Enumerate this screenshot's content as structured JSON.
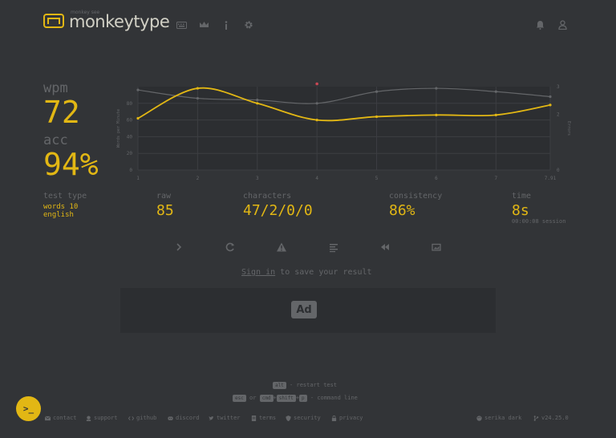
{
  "header": {
    "logo_sub": "monkey see",
    "logo_text": "monkeytype",
    "nav_icons": [
      "keyboard-icon",
      "crown-icon",
      "info-icon",
      "gear-icon"
    ],
    "right_icons": [
      "bell-icon",
      "user-icon"
    ]
  },
  "stats": {
    "wpm_label": "wpm",
    "wpm": "72",
    "acc_label": "acc",
    "acc": "94%",
    "test_type_label": "test type",
    "test_type_line1": "words 10",
    "test_type_line2": "english",
    "raw_label": "raw",
    "raw": "85",
    "characters_label": "characters",
    "characters": "47/2/0/0",
    "consistency_label": "consistency",
    "consistency": "86%",
    "time_label": "time",
    "time": "8s",
    "session": "00:00:08 session"
  },
  "chart_data": {
    "type": "line",
    "x": [
      1,
      2,
      3,
      4,
      5,
      6,
      7,
      7.91
    ],
    "xtick_labels": [
      "1",
      "2",
      "3",
      "4",
      "5",
      "6",
      "7",
      "7.91"
    ],
    "ylabel": "Words per Minute",
    "y2label": "Errors",
    "ylim": [
      0,
      100
    ],
    "yticks": [
      0,
      20,
      40,
      60,
      80
    ],
    "y2lim": [
      0,
      3
    ],
    "y2ticks": [
      0,
      2,
      3
    ],
    "grid": true,
    "series": [
      {
        "role": "raw",
        "color": "#646669",
        "values": [
          96,
          86,
          84,
          80,
          94,
          98,
          94,
          88
        ]
      },
      {
        "role": "wpm",
        "color": "#e2b714",
        "values": [
          62,
          98,
          80,
          60,
          64,
          66,
          66,
          78
        ]
      },
      {
        "role": "errors",
        "color": "#ca4754",
        "points": [
          [
            4,
            3.1
          ]
        ]
      }
    ]
  },
  "controls": [
    "next-test-icon",
    "restart-icon",
    "warning-icon",
    "list-icon",
    "rewind-icon",
    "screenshot-icon"
  ],
  "signin": {
    "link": "Sign in",
    "rest": " to save your result"
  },
  "ad": {
    "label": "Ad"
  },
  "hints": {
    "key1": "alt",
    "line1": " - restart test",
    "key_esc": "esc",
    "or": " or ",
    "key_cmd": "cmd",
    "plus": "+",
    "key_shift": "shift",
    "key_p": "p",
    "line2": " - command line"
  },
  "footer": {
    "links": [
      "contact",
      "support",
      "github",
      "discord",
      "twitter",
      "terms",
      "security",
      "privacy"
    ],
    "theme": "serika dark",
    "version": "v24.25.0",
    "cmd_glyph": ">_"
  },
  "colors": {
    "bg": "#323437",
    "main": "#e2b714",
    "sub": "#646669",
    "text": "#d1d0c5",
    "error": "#ca4754",
    "sub_alt": "#2c2e31"
  }
}
